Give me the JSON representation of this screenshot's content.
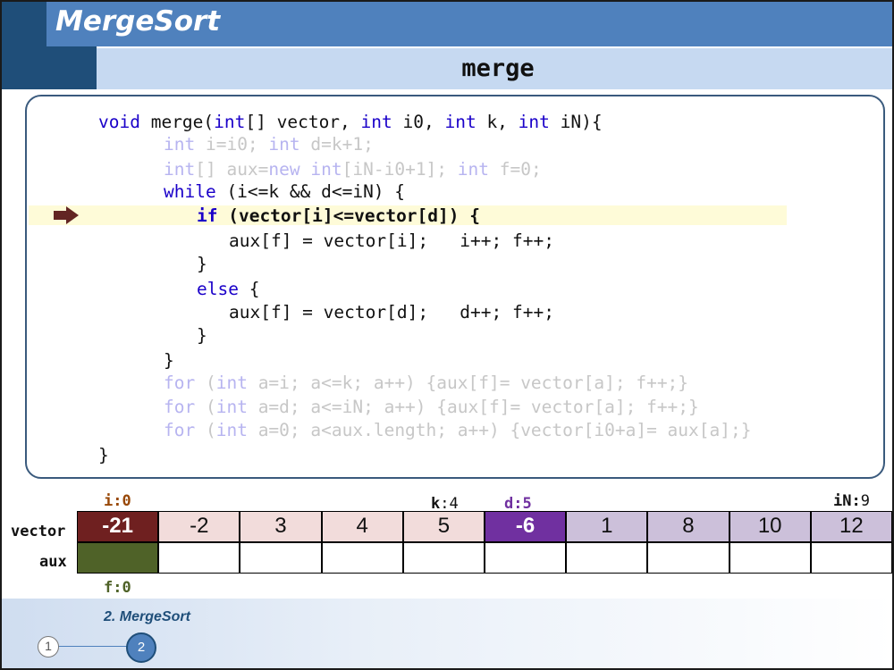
{
  "header": {
    "title": "MergeSort",
    "subtitle": "merge"
  },
  "code": {
    "lines": [
      {
        "indent": 0,
        "state": "normal",
        "tokens": [
          {
            "t": "void",
            "k": 1
          },
          {
            "t": " merge("
          },
          {
            "t": "int",
            "k": 1
          },
          {
            "t": "[] vector, "
          },
          {
            "t": "int",
            "k": 1
          },
          {
            "t": " i0, "
          },
          {
            "t": "int",
            "k": 1
          },
          {
            "t": " k, "
          },
          {
            "t": "int",
            "k": 1
          },
          {
            "t": " iN){"
          }
        ]
      },
      {
        "indent": 1,
        "state": "faded",
        "tokens": [
          {
            "t": "int",
            "k": 1
          },
          {
            "t": " i=i0; "
          },
          {
            "t": "int",
            "k": 1
          },
          {
            "t": " d=k+1;"
          }
        ]
      },
      {
        "indent": 1,
        "state": "faded",
        "tokens": [
          {
            "t": "int",
            "k": 1
          },
          {
            "t": "[] aux="
          },
          {
            "t": "new",
            "k": 1
          },
          {
            "t": " "
          },
          {
            "t": "int",
            "k": 1
          },
          {
            "t": "[iN-i0+1]; "
          },
          {
            "t": "int",
            "k": 1
          },
          {
            "t": " f=0;"
          }
        ]
      },
      {
        "indent": 1,
        "state": "normal",
        "tokens": [
          {
            "t": "while",
            "k": 1
          },
          {
            "t": " (i<=k && d<=iN) {"
          }
        ]
      },
      {
        "indent": 2,
        "state": "current",
        "tokens": [
          {
            "t": "if",
            "k": 1
          },
          {
            "t": " (vector[i]<=vector[d]) {"
          }
        ]
      },
      {
        "indent": 3,
        "state": "normal",
        "tokens": [
          {
            "t": "aux[f] = vector[i];   i++; f++;"
          }
        ]
      },
      {
        "indent": 2,
        "state": "normal",
        "tokens": [
          {
            "t": "}"
          }
        ]
      },
      {
        "indent": 2,
        "state": "normal",
        "tokens": [
          {
            "t": "else",
            "k": 1
          },
          {
            "t": " {"
          }
        ]
      },
      {
        "indent": 3,
        "state": "normal",
        "tokens": [
          {
            "t": "aux[f] = vector[d];   d++; f++;"
          }
        ]
      },
      {
        "indent": 2,
        "state": "normal",
        "tokens": [
          {
            "t": "}"
          }
        ]
      },
      {
        "indent": 1,
        "state": "normal",
        "tokens": [
          {
            "t": "}"
          }
        ]
      },
      {
        "indent": 1,
        "state": "faded",
        "tokens": [
          {
            "t": "for",
            "k": 1
          },
          {
            "t": " ("
          },
          {
            "t": "int",
            "k": 1
          },
          {
            "t": " a=i; a<=k; a++) {aux[f]= vector[a]; f++;}"
          }
        ]
      },
      {
        "indent": 1,
        "state": "faded",
        "tokens": [
          {
            "t": "for",
            "k": 1
          },
          {
            "t": " ("
          },
          {
            "t": "int",
            "k": 1
          },
          {
            "t": " a=d; a<=iN; a++) {aux[f]= vector[a]; f++;}"
          }
        ]
      },
      {
        "indent": 1,
        "state": "faded",
        "tokens": [
          {
            "t": "for",
            "k": 1
          },
          {
            "t": " ("
          },
          {
            "t": "int",
            "k": 1
          },
          {
            "t": " a=0; a<aux.length; a++) {vector[i0+a]= aux[a];}"
          }
        ]
      },
      {
        "indent": 0,
        "state": "normal",
        "tokens": [
          {
            "t": "}"
          }
        ]
      }
    ],
    "current_line": 4
  },
  "arrays": {
    "vector_label": "vector",
    "aux_label": "aux",
    "vector": [
      {
        "v": "-21",
        "bg": "#6f2020",
        "sel": true
      },
      {
        "v": "-2",
        "bg": "#f2dcdb"
      },
      {
        "v": "3",
        "bg": "#f2dcdb"
      },
      {
        "v": "4",
        "bg": "#f2dcdb"
      },
      {
        "v": "5",
        "bg": "#f2dcdb"
      },
      {
        "v": "-6",
        "bg": "#7030a0",
        "sel": true
      },
      {
        "v": "1",
        "bg": "#ccc0da"
      },
      {
        "v": "8",
        "bg": "#ccc0da"
      },
      {
        "v": "10",
        "bg": "#ccc0da"
      },
      {
        "v": "12",
        "bg": "#ccc0da"
      }
    ],
    "aux": [
      {
        "v": "",
        "bg": "#4f6228"
      },
      {
        "v": "",
        "bg": "#ffffff"
      },
      {
        "v": "",
        "bg": "#ffffff"
      },
      {
        "v": "",
        "bg": "#ffffff"
      },
      {
        "v": "",
        "bg": "#ffffff"
      },
      {
        "v": "",
        "bg": "#ffffff"
      },
      {
        "v": "",
        "bg": "#ffffff"
      },
      {
        "v": "",
        "bg": "#ffffff"
      },
      {
        "v": "",
        "bg": "#ffffff"
      },
      {
        "v": "",
        "bg": "#ffffff"
      }
    ]
  },
  "variables": {
    "i": {
      "name": "i",
      "value": "0",
      "color": "#984807"
    },
    "k": {
      "name": "k",
      "value": "4",
      "color": "#111111"
    },
    "d": {
      "name": "d",
      "value": "5",
      "color": "#7030a0"
    },
    "iN": {
      "name": "iN",
      "value": "9",
      "color": "#111111"
    },
    "f": {
      "name": "f",
      "value": "0",
      "color": "#4f6228"
    }
  },
  "footer": {
    "section": "2. MergeSort",
    "steps": [
      "1",
      "2"
    ],
    "active_step": "2"
  },
  "colors": {
    "accent": "#4f81bd",
    "dark_accent": "#1f4e79",
    "subtitle_bar": "#c6d9f1",
    "highlight": "#fefbd8",
    "arrow": "#632523",
    "keyword": "#1a00c9"
  }
}
